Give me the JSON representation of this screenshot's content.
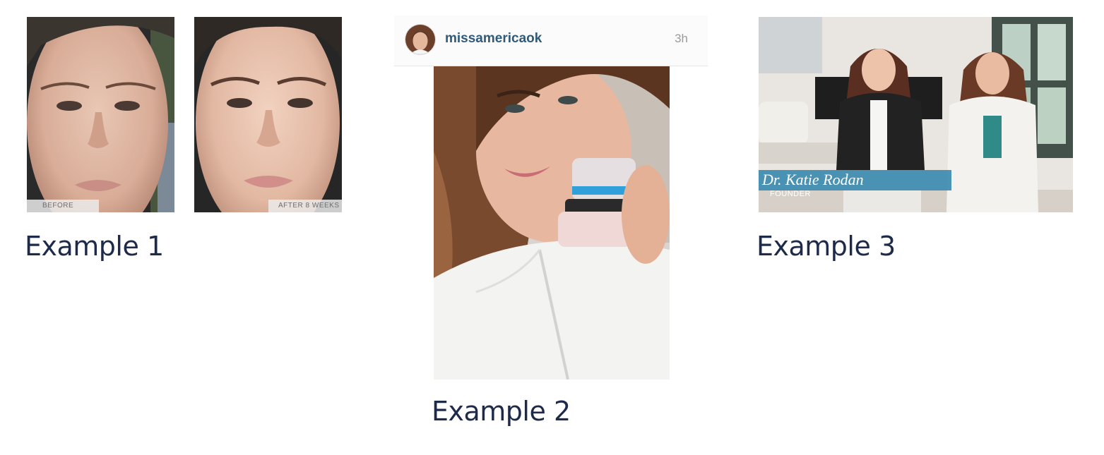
{
  "examples": [
    {
      "caption": "Example 1",
      "photos": [
        {
          "label": "BEFORE",
          "icon": "face-photo-before"
        },
        {
          "label": "AFTER 8 WEEKS",
          "icon": "face-photo-after"
        }
      ]
    },
    {
      "caption": "Example 2",
      "post": {
        "username": "missamericaok",
        "time": "3h",
        "avatar": "profile-avatar",
        "photo": "selfie-with-product-jars"
      }
    },
    {
      "caption": "Example 3",
      "video": {
        "name_overlay": "Dr. Katie Rodan",
        "role_overlay": "FOUNDER",
        "photo": "two-founders-seated"
      }
    }
  ],
  "colors": {
    "caption": "#1d2a4a",
    "username": "#2f5a7a",
    "lower_third": "#2e82aa"
  }
}
